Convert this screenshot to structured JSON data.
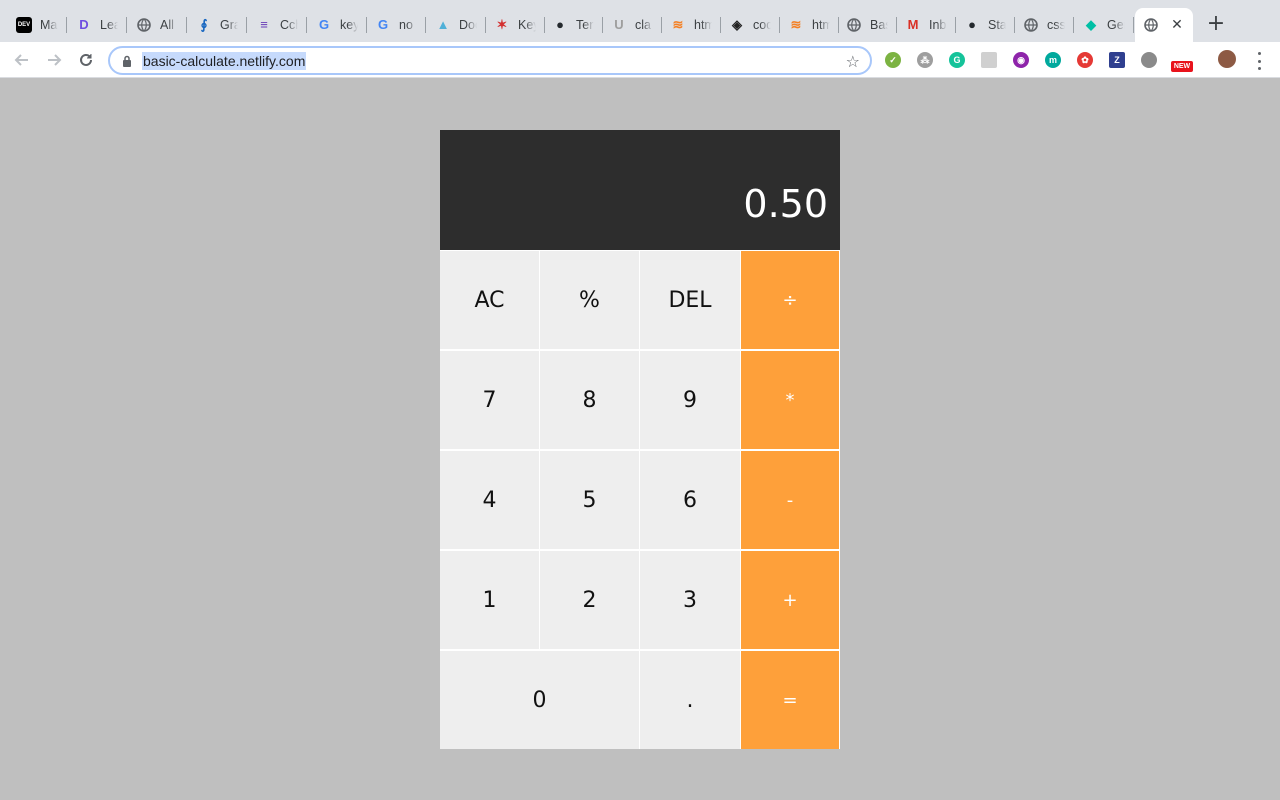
{
  "browser": {
    "tabs": [
      {
        "title": "Mak",
        "icon": "dev-icon",
        "fav_text": "DEV",
        "color": "#000000"
      },
      {
        "title": "Lea",
        "icon": "learning-icon",
        "fav_text": "D",
        "color": "#6f4de0"
      },
      {
        "title": "All ",
        "icon": "globe-icon",
        "fav_text": "",
        "color": "#5f6368"
      },
      {
        "title": "Gra",
        "icon": "graphql-icon",
        "fav_text": "∮",
        "color": "#1565c0"
      },
      {
        "title": "Cch",
        "icon": "sheet-icon",
        "fav_text": "≡",
        "color": "#673ab7"
      },
      {
        "title": "key",
        "icon": "google-icon",
        "fav_text": "G",
        "color": "#4285f4"
      },
      {
        "title": "no ",
        "icon": "google-icon",
        "fav_text": "G",
        "color": "#4285f4"
      },
      {
        "title": "Doc",
        "icon": "docs-icon",
        "fav_text": "▲",
        "color": "#4fb0d8"
      },
      {
        "title": "Key",
        "icon": "keycode-icon",
        "fav_text": "✶",
        "color": "#d32f2f"
      },
      {
        "title": "Ter",
        "icon": "github-icon",
        "fav_text": "●",
        "color": "#24292e"
      },
      {
        "title": "cla",
        "icon": "udacity-icon",
        "fav_text": "U",
        "color": "#9e9e9e"
      },
      {
        "title": "htm",
        "icon": "stackoverflow-icon",
        "fav_text": "≋",
        "color": "#f48024"
      },
      {
        "title": "cod",
        "icon": "codepen-icon",
        "fav_text": "◈",
        "color": "#222222"
      },
      {
        "title": "htm",
        "icon": "stackoverflow-icon",
        "fav_text": "≋",
        "color": "#f48024"
      },
      {
        "title": "Bas",
        "icon": "globe-icon",
        "fav_text": "",
        "color": "#5f6368"
      },
      {
        "title": "Inb",
        "icon": "gmail-icon",
        "fav_text": "M",
        "color": "#d93025"
      },
      {
        "title": "Sta",
        "icon": "github-icon",
        "fav_text": "●",
        "color": "#24292e"
      },
      {
        "title": "css",
        "icon": "globe-icon",
        "fav_text": "",
        "color": "#5f6368"
      },
      {
        "title": "Ger",
        "icon": "gem-icon",
        "fav_text": "◆",
        "color": "#00bfa5"
      },
      {
        "title": "",
        "icon": "globe-icon",
        "fav_text": "",
        "color": "#5f6368",
        "active": true
      }
    ],
    "url": "basic-calculate.netlify.com",
    "extensions": [
      {
        "name": "inbox-extension-icon",
        "color": "#7cb342",
        "text": "✓"
      },
      {
        "name": "tree-extension-icon",
        "color": "#9e9e9e",
        "text": "⁂"
      },
      {
        "name": "grammarly-extension-icon",
        "color": "#15c39a",
        "text": "G"
      },
      {
        "name": "screen-extension-icon",
        "color": "#d0d0d0",
        "text": ""
      },
      {
        "name": "octo-extension-icon",
        "color": "#8e24aa",
        "text": "◉"
      },
      {
        "name": "m-extension-icon",
        "color": "#00a99d",
        "text": "m"
      },
      {
        "name": "colors-extension-icon",
        "color": "#e53935",
        "text": "✿"
      },
      {
        "name": "zotero-extension-icon",
        "color": "#2f3f8f",
        "text": "Z"
      },
      {
        "name": "gray-extension-icon",
        "color": "#8a8a8a",
        "text": ""
      },
      {
        "name": "new-extension-icon",
        "color": "#e8131c",
        "text": "NEW"
      },
      {
        "name": "profile-avatar-icon",
        "color": "#8d5a44",
        "text": ""
      }
    ]
  },
  "calculator": {
    "display_value": "0.50",
    "keys": [
      {
        "label": "AC",
        "type": "fn",
        "name": "all-clear-button"
      },
      {
        "label": "%",
        "type": "fn",
        "name": "percent-button"
      },
      {
        "label": "DEL",
        "type": "fn",
        "name": "delete-button"
      },
      {
        "label": "÷",
        "type": "op",
        "name": "divide-button"
      },
      {
        "label": "7",
        "type": "num",
        "name": "digit-7-button"
      },
      {
        "label": "8",
        "type": "num",
        "name": "digit-8-button"
      },
      {
        "label": "9",
        "type": "num",
        "name": "digit-9-button"
      },
      {
        "label": "*",
        "type": "op",
        "name": "multiply-button"
      },
      {
        "label": "4",
        "type": "num",
        "name": "digit-4-button"
      },
      {
        "label": "5",
        "type": "num",
        "name": "digit-5-button"
      },
      {
        "label": "6",
        "type": "num",
        "name": "digit-6-button"
      },
      {
        "label": "-",
        "type": "op",
        "name": "subtract-button"
      },
      {
        "label": "1",
        "type": "num",
        "name": "digit-1-button"
      },
      {
        "label": "2",
        "type": "num",
        "name": "digit-2-button"
      },
      {
        "label": "3",
        "type": "num",
        "name": "digit-3-button"
      },
      {
        "label": "+",
        "type": "op",
        "name": "add-button"
      },
      {
        "label": "0",
        "type": "num",
        "name": "digit-0-button",
        "wide": true
      },
      {
        "label": ".",
        "type": "num",
        "name": "decimal-button"
      },
      {
        "label": "=",
        "type": "op",
        "name": "equals-button"
      }
    ],
    "colors": {
      "operator": "#fea03a",
      "key": "#eeeeee",
      "display_bg": "#2d2d2d",
      "page_bg": "#bfbfbf"
    }
  }
}
